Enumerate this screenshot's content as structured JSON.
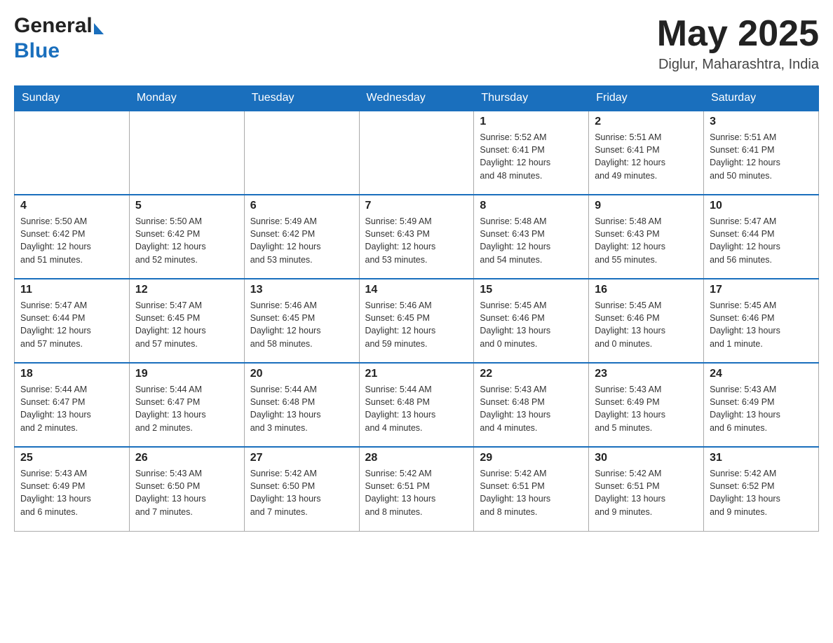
{
  "header": {
    "logo_general": "General",
    "logo_blue": "Blue",
    "month_title": "May 2025",
    "location": "Diglur, Maharashtra, India"
  },
  "days_of_week": [
    "Sunday",
    "Monday",
    "Tuesday",
    "Wednesday",
    "Thursday",
    "Friday",
    "Saturday"
  ],
  "weeks": [
    [
      {
        "day": "",
        "info": ""
      },
      {
        "day": "",
        "info": ""
      },
      {
        "day": "",
        "info": ""
      },
      {
        "day": "",
        "info": ""
      },
      {
        "day": "1",
        "info": "Sunrise: 5:52 AM\nSunset: 6:41 PM\nDaylight: 12 hours\nand 48 minutes."
      },
      {
        "day": "2",
        "info": "Sunrise: 5:51 AM\nSunset: 6:41 PM\nDaylight: 12 hours\nand 49 minutes."
      },
      {
        "day": "3",
        "info": "Sunrise: 5:51 AM\nSunset: 6:41 PM\nDaylight: 12 hours\nand 50 minutes."
      }
    ],
    [
      {
        "day": "4",
        "info": "Sunrise: 5:50 AM\nSunset: 6:42 PM\nDaylight: 12 hours\nand 51 minutes."
      },
      {
        "day": "5",
        "info": "Sunrise: 5:50 AM\nSunset: 6:42 PM\nDaylight: 12 hours\nand 52 minutes."
      },
      {
        "day": "6",
        "info": "Sunrise: 5:49 AM\nSunset: 6:42 PM\nDaylight: 12 hours\nand 53 minutes."
      },
      {
        "day": "7",
        "info": "Sunrise: 5:49 AM\nSunset: 6:43 PM\nDaylight: 12 hours\nand 53 minutes."
      },
      {
        "day": "8",
        "info": "Sunrise: 5:48 AM\nSunset: 6:43 PM\nDaylight: 12 hours\nand 54 minutes."
      },
      {
        "day": "9",
        "info": "Sunrise: 5:48 AM\nSunset: 6:43 PM\nDaylight: 12 hours\nand 55 minutes."
      },
      {
        "day": "10",
        "info": "Sunrise: 5:47 AM\nSunset: 6:44 PM\nDaylight: 12 hours\nand 56 minutes."
      }
    ],
    [
      {
        "day": "11",
        "info": "Sunrise: 5:47 AM\nSunset: 6:44 PM\nDaylight: 12 hours\nand 57 minutes."
      },
      {
        "day": "12",
        "info": "Sunrise: 5:47 AM\nSunset: 6:45 PM\nDaylight: 12 hours\nand 57 minutes."
      },
      {
        "day": "13",
        "info": "Sunrise: 5:46 AM\nSunset: 6:45 PM\nDaylight: 12 hours\nand 58 minutes."
      },
      {
        "day": "14",
        "info": "Sunrise: 5:46 AM\nSunset: 6:45 PM\nDaylight: 12 hours\nand 59 minutes."
      },
      {
        "day": "15",
        "info": "Sunrise: 5:45 AM\nSunset: 6:46 PM\nDaylight: 13 hours\nand 0 minutes."
      },
      {
        "day": "16",
        "info": "Sunrise: 5:45 AM\nSunset: 6:46 PM\nDaylight: 13 hours\nand 0 minutes."
      },
      {
        "day": "17",
        "info": "Sunrise: 5:45 AM\nSunset: 6:46 PM\nDaylight: 13 hours\nand 1 minute."
      }
    ],
    [
      {
        "day": "18",
        "info": "Sunrise: 5:44 AM\nSunset: 6:47 PM\nDaylight: 13 hours\nand 2 minutes."
      },
      {
        "day": "19",
        "info": "Sunrise: 5:44 AM\nSunset: 6:47 PM\nDaylight: 13 hours\nand 2 minutes."
      },
      {
        "day": "20",
        "info": "Sunrise: 5:44 AM\nSunset: 6:48 PM\nDaylight: 13 hours\nand 3 minutes."
      },
      {
        "day": "21",
        "info": "Sunrise: 5:44 AM\nSunset: 6:48 PM\nDaylight: 13 hours\nand 4 minutes."
      },
      {
        "day": "22",
        "info": "Sunrise: 5:43 AM\nSunset: 6:48 PM\nDaylight: 13 hours\nand 4 minutes."
      },
      {
        "day": "23",
        "info": "Sunrise: 5:43 AM\nSunset: 6:49 PM\nDaylight: 13 hours\nand 5 minutes."
      },
      {
        "day": "24",
        "info": "Sunrise: 5:43 AM\nSunset: 6:49 PM\nDaylight: 13 hours\nand 6 minutes."
      }
    ],
    [
      {
        "day": "25",
        "info": "Sunrise: 5:43 AM\nSunset: 6:49 PM\nDaylight: 13 hours\nand 6 minutes."
      },
      {
        "day": "26",
        "info": "Sunrise: 5:43 AM\nSunset: 6:50 PM\nDaylight: 13 hours\nand 7 minutes."
      },
      {
        "day": "27",
        "info": "Sunrise: 5:42 AM\nSunset: 6:50 PM\nDaylight: 13 hours\nand 7 minutes."
      },
      {
        "day": "28",
        "info": "Sunrise: 5:42 AM\nSunset: 6:51 PM\nDaylight: 13 hours\nand 8 minutes."
      },
      {
        "day": "29",
        "info": "Sunrise: 5:42 AM\nSunset: 6:51 PM\nDaylight: 13 hours\nand 8 minutes."
      },
      {
        "day": "30",
        "info": "Sunrise: 5:42 AM\nSunset: 6:51 PM\nDaylight: 13 hours\nand 9 minutes."
      },
      {
        "day": "31",
        "info": "Sunrise: 5:42 AM\nSunset: 6:52 PM\nDaylight: 13 hours\nand 9 minutes."
      }
    ]
  ]
}
